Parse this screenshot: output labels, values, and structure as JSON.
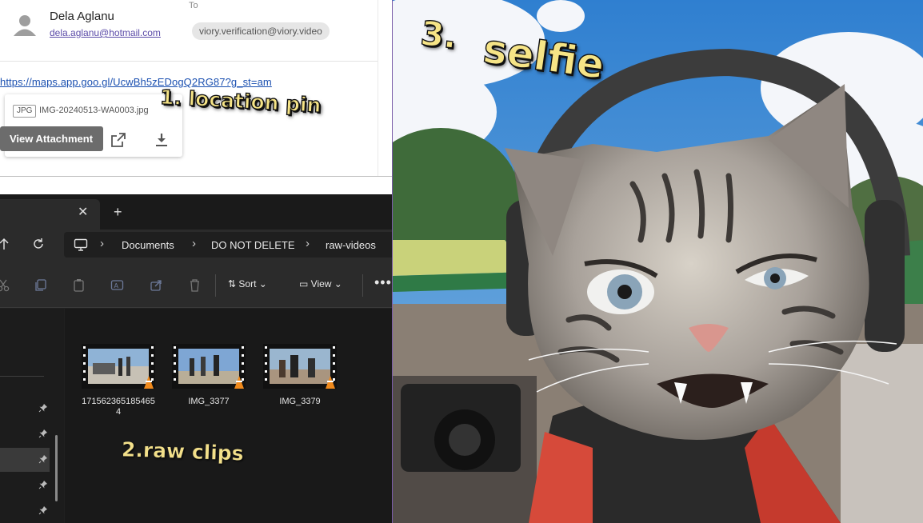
{
  "email": {
    "sender_name": "Dela Aglanu",
    "sender_email": "dela.aglanu@hotmail.com",
    "to_label": "To",
    "recipient": "viory.verification@viory.video",
    "link": "https://maps.app.goo.gl/UcwBh5zEDogQ2RG87?g_st=am",
    "attachment": {
      "type_badge": "JPG",
      "file_name": "IMG-20240513-WA0003.jpg",
      "view_label": "View Attachment",
      "icons": [
        "open-external-icon",
        "download-icon"
      ]
    }
  },
  "explorer": {
    "tab_close": "✕",
    "new_tab": "+",
    "breadcrumb": [
      "Documents",
      "DO NOT DELETE",
      "raw-videos"
    ],
    "toolbar": {
      "sort_label": "Sort",
      "view_label": "View",
      "more_label": "•••",
      "icons": [
        "cut-icon",
        "copy-icon",
        "paste-icon",
        "rename-icon",
        "share-icon",
        "delete-icon"
      ]
    },
    "files": [
      {
        "name": "171562365185465 4"
      },
      {
        "name": "IMG_3377"
      },
      {
        "name": "IMG_3379"
      }
    ]
  },
  "annotations": {
    "location": "1. location pin",
    "raw": "2.raw clips",
    "selfie_num": "3.",
    "selfie_word": "selfie"
  },
  "colors": {
    "annotation_fill": "#f6e486",
    "link": "#1a4fb0",
    "explorer_bg": "#202020"
  }
}
